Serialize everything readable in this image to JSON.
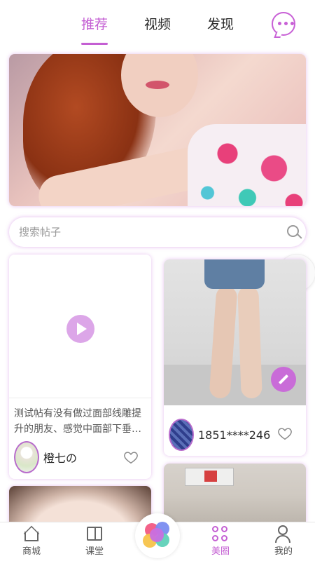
{
  "tabs": [
    {
      "label": "推荐",
      "active": true
    },
    {
      "label": "视频",
      "active": false
    },
    {
      "label": "发现",
      "active": false
    }
  ],
  "header": {
    "message_icon": "chat-bubble-icon"
  },
  "colors": {
    "accent": "#c45fd3",
    "accent_light": "#dca6e8"
  },
  "search": {
    "placeholder": "搜索帖子",
    "value": ""
  },
  "posts": [
    {
      "type": "video",
      "text_line1": "测试帖有没有做过面部线雕提",
      "text_line2": "升的朋友、感觉中面部下垂…",
      "author": "橙七の",
      "liked": false
    },
    {
      "type": "image",
      "author": "1851****246",
      "liked": false
    }
  ],
  "bottom_nav": [
    {
      "label": "商城",
      "icon": "home-icon",
      "active": false
    },
    {
      "label": "课堂",
      "icon": "book-icon",
      "active": false
    },
    {
      "label": "",
      "icon": "flower-logo-icon",
      "active": false
    },
    {
      "label": "美圈",
      "icon": "community-icon",
      "active": true
    },
    {
      "label": "我的",
      "icon": "profile-icon",
      "active": false
    }
  ]
}
